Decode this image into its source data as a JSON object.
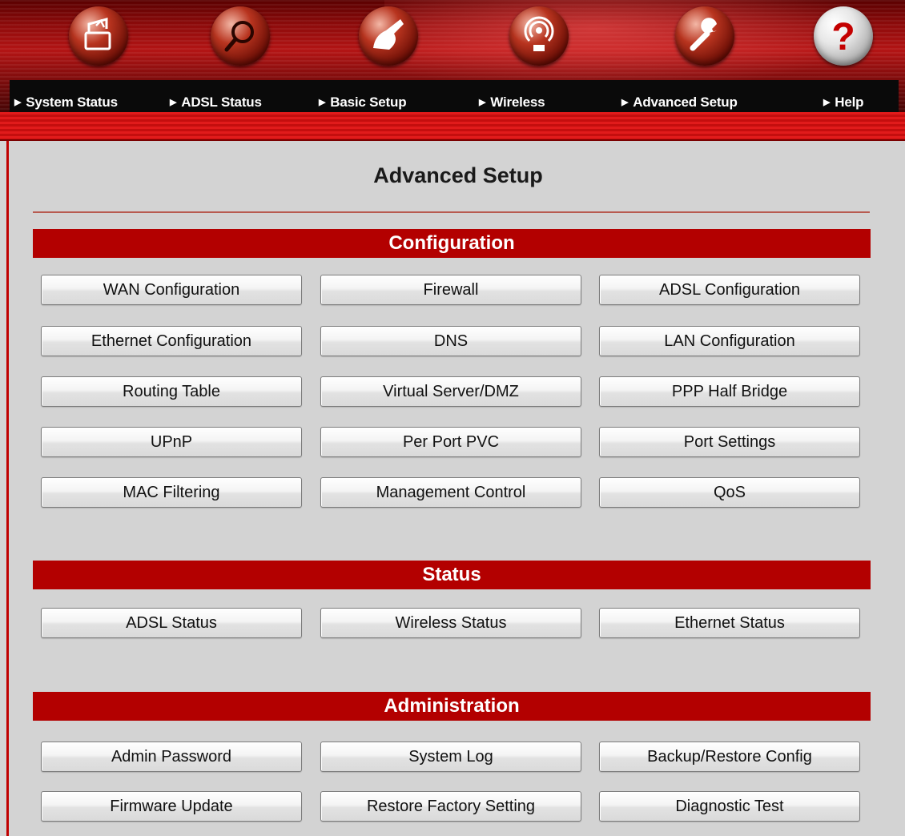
{
  "nav": {
    "items": [
      {
        "label": "System Status",
        "icon": "folder-upload-icon"
      },
      {
        "label": "ADSL Status",
        "icon": "magnifier-icon"
      },
      {
        "label": "Basic Setup",
        "icon": "hand-pointer-icon"
      },
      {
        "label": "Wireless",
        "icon": "wireless-antenna-icon"
      },
      {
        "label": "Advanced Setup",
        "icon": "wrench-icon"
      },
      {
        "label": "Help",
        "icon": "question-mark-icon"
      }
    ],
    "arrow_glyph": "▶"
  },
  "page": {
    "title": "Advanced Setup"
  },
  "sections": {
    "configuration": {
      "title": "Configuration",
      "buttons": [
        "WAN Configuration",
        "Firewall",
        "ADSL Configuration",
        "Ethernet Configuration",
        "DNS",
        "LAN Configuration",
        "Routing Table",
        "Virtual Server/DMZ",
        "PPP Half Bridge",
        "UPnP",
        "Per Port PVC",
        "Port Settings",
        "MAC Filtering",
        "Management Control",
        "QoS"
      ]
    },
    "status": {
      "title": "Status",
      "buttons": [
        "ADSL Status",
        "Wireless Status",
        "Ethernet Status"
      ]
    },
    "administration": {
      "title": "Administration",
      "buttons": [
        "Admin Password",
        "System Log",
        "Backup/Restore Config",
        "Firmware Update",
        "Restore Factory Setting",
        "Diagnostic Test"
      ]
    }
  },
  "colors": {
    "section_bar": "#b30000",
    "nav_background": "#0a0a0a",
    "panel_background": "#d3d3d3",
    "accent_red": "#e11b1b"
  }
}
